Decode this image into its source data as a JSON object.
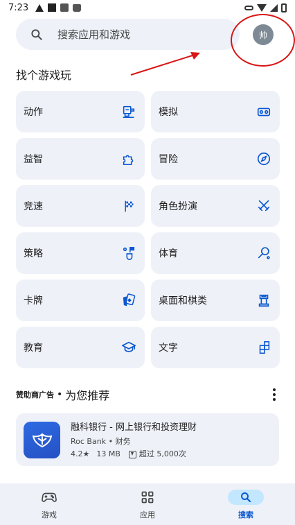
{
  "status_bar": {
    "time": "7:23",
    "left_icons": [
      "warning-icon",
      "square-icon",
      "app-notification-icon",
      "android-icon"
    ],
    "right_icons": [
      "vpn-key-icon",
      "wifi-icon",
      "signal-icon",
      "battery-icon"
    ]
  },
  "search": {
    "placeholder": "搜索应用和游戏",
    "icon": "search-icon"
  },
  "avatar": {
    "initial": "帅",
    "color": "#7d8a95"
  },
  "section_title": "找个游戏玩",
  "categories": [
    {
      "label": "动作",
      "icon": "action-icon"
    },
    {
      "label": "模拟",
      "icon": "vr-headset-icon"
    },
    {
      "label": "益智",
      "icon": "puzzle-icon"
    },
    {
      "label": "冒险",
      "icon": "compass-icon"
    },
    {
      "label": "竞速",
      "icon": "checkered-flag-icon"
    },
    {
      "label": "角色扮演",
      "icon": "crossed-swords-icon"
    },
    {
      "label": "策略",
      "icon": "strategy-icon"
    },
    {
      "label": "体育",
      "icon": "badminton-icon"
    },
    {
      "label": "卡牌",
      "icon": "cards-icon"
    },
    {
      "label": "桌面和棋类",
      "icon": "chess-rook-icon"
    },
    {
      "label": "教育",
      "icon": "graduation-cap-icon"
    },
    {
      "label": "文字",
      "icon": "word-blocks-icon"
    }
  ],
  "recommendations": {
    "ad_label": "赞助商广告",
    "separator": "•",
    "title": "为您推荐",
    "more_icon": "more-vert-icon"
  },
  "app": {
    "name": "融科银行 - 网上银行和投资理财",
    "developer": "Roc Bank",
    "dot": "•",
    "category": "财务",
    "rating": "4.2★",
    "size": "13 MB",
    "downloads": "超过 5,000次",
    "logo_color": "#2d6be3"
  },
  "bottom_nav": [
    {
      "label": "游戏",
      "icon": "gamepad-icon",
      "active": false
    },
    {
      "label": "应用",
      "icon": "apps-grid-icon",
      "active": false
    },
    {
      "label": "搜索",
      "icon": "search-icon",
      "active": true
    }
  ],
  "colors": {
    "accent": "#0b57d0",
    "tile_bg": "#eef1f8",
    "active_pill": "#c2e7ff",
    "annotation_red": "#d81616"
  }
}
